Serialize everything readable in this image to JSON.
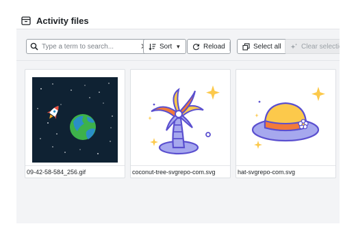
{
  "header": {
    "title": "Activity files",
    "icon": "files-box-icon"
  },
  "toolbar": {
    "search_placeholder": "Type a term to search...",
    "search_value": "",
    "clear_symbol": "✕",
    "sort_label": "Sort",
    "sort_caret": "▼",
    "reload_label": "Reload",
    "select_all_label": "Select all",
    "clear_selection_label": "Clear selection"
  },
  "files": [
    {
      "name": "09-42-58-584_256.gif",
      "thumbnail": "rocket-earth-space-image"
    },
    {
      "name": "coconut-tree-svgrepo-com.svg",
      "thumbnail": "palm-tree-image"
    },
    {
      "name": "hat-svgrepo-com.svg",
      "thumbnail": "sun-hat-image"
    }
  ],
  "colors": {
    "panel_bg": "#f3f4f6",
    "space_bg": "#0f2233",
    "accent_yellow": "#fcc94b",
    "outline_purple": "#5a4fcf",
    "lavender": "#a6a8ee",
    "orange": "#f27a3a"
  }
}
